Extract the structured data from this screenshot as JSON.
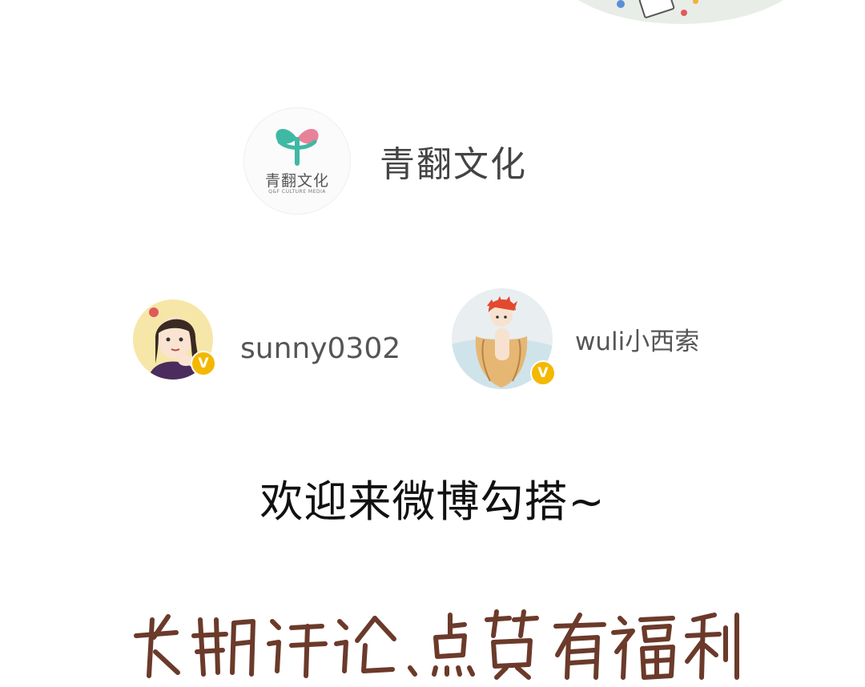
{
  "brand": {
    "name": "青翻文化",
    "logo_cn": "青翻文化",
    "logo_en": "Q&F CULTURE MEDIA"
  },
  "users": [
    {
      "username": "sunny0302",
      "badge": "V",
      "avatar_icon": "girl-avatar-icon"
    },
    {
      "username": "wuli小西索",
      "badge": "V",
      "avatar_icon": "boy-avatar-icon"
    }
  ],
  "welcome_text": "欢迎来微博勾搭~",
  "handwritten_text": "长期评论，点赞有福利！",
  "colors": {
    "brand_green": "#3fb8a4",
    "brand_pink": "#e8829b",
    "verified_gold": "#f5b800",
    "handwriting_brown": "#6b3a2a"
  }
}
